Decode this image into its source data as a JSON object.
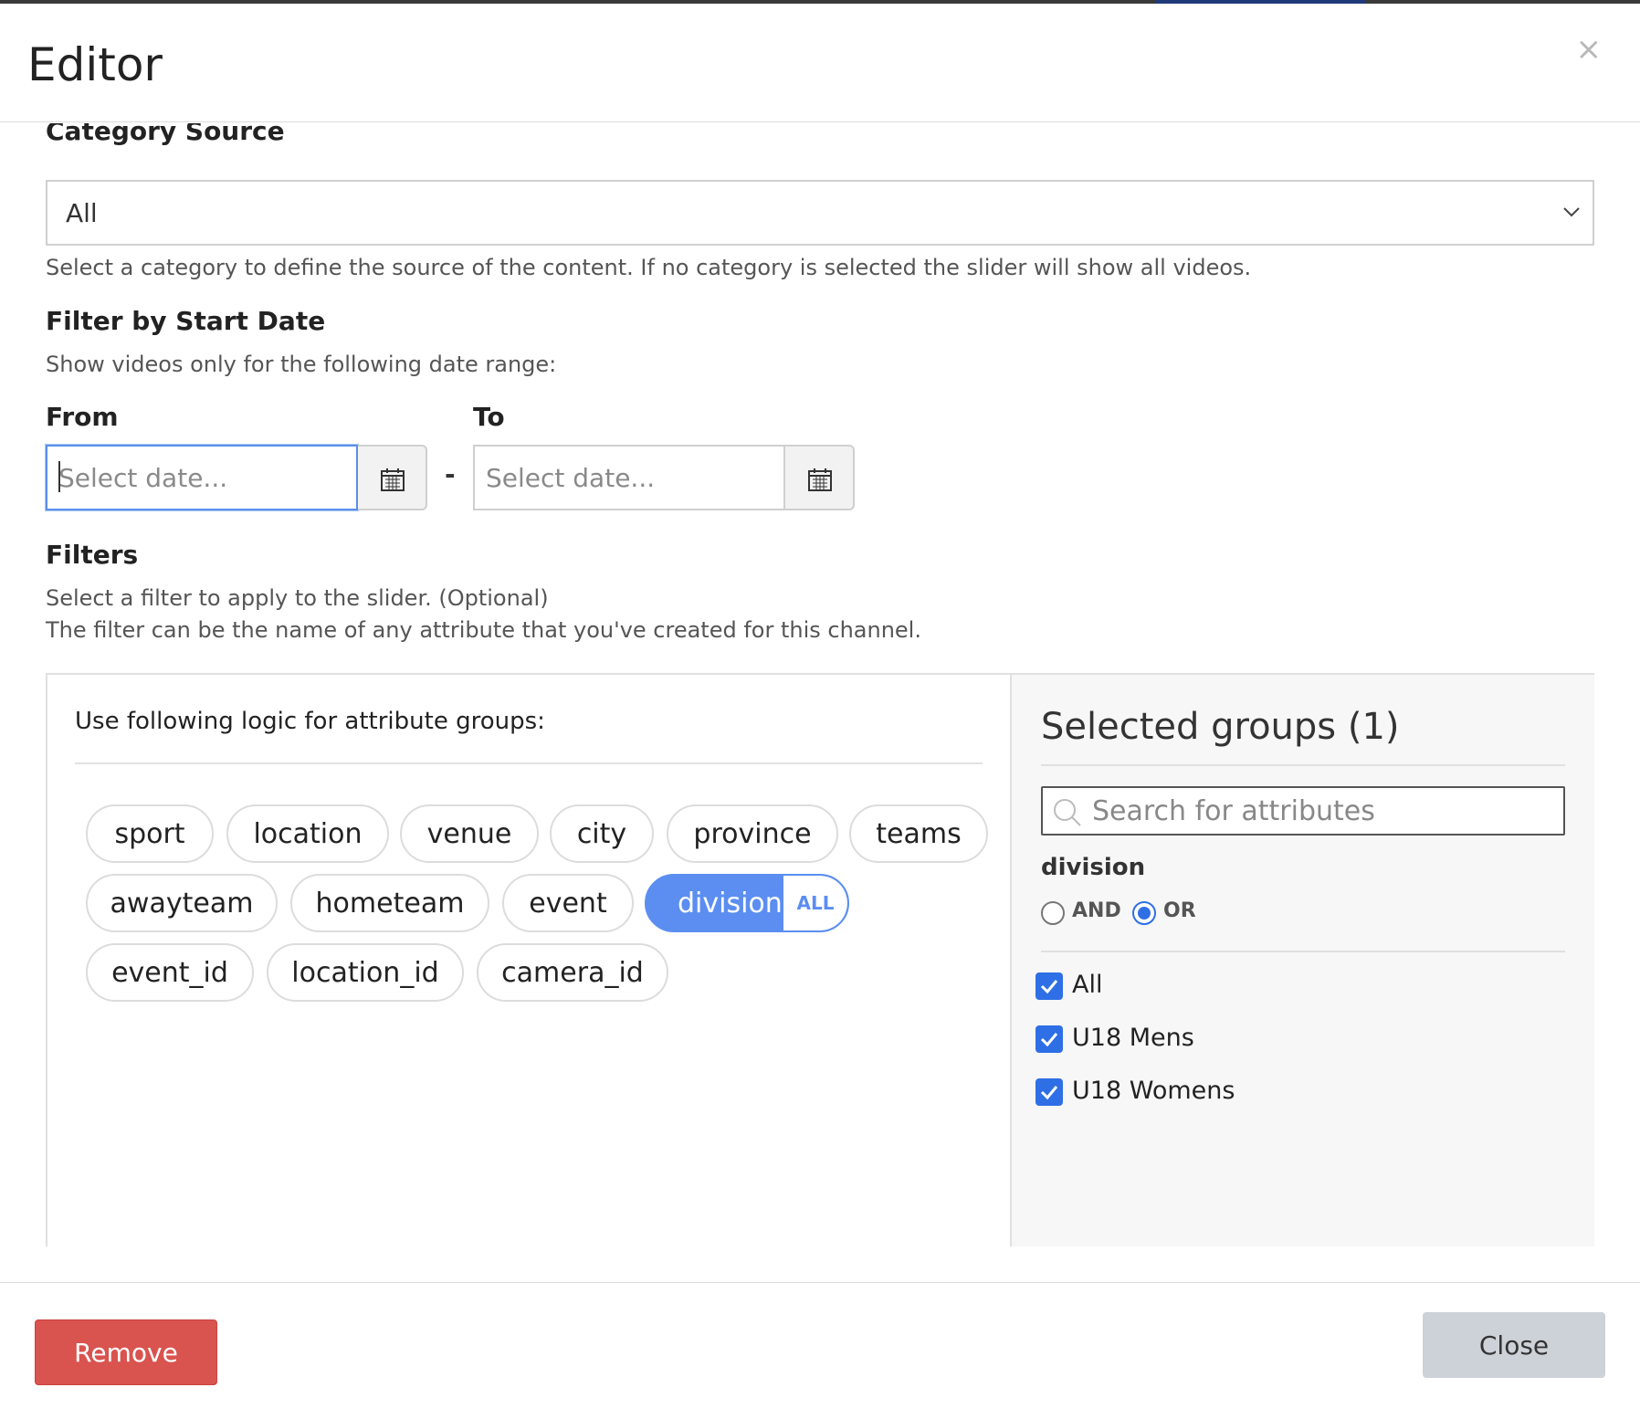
{
  "dialog": {
    "title": "Editor",
    "close_icon": "×"
  },
  "category": {
    "label": "Category Source",
    "selected": "All",
    "help": "Select a category to define the source of the content. If no category is selected the slider will show all videos."
  },
  "date_filter": {
    "label": "Filter by Start Date",
    "help": "Show videos only for the following date range:",
    "from_label": "From",
    "to_label": "To",
    "from_placeholder": "Select date...",
    "to_placeholder": "Select date...",
    "separator": "-"
  },
  "filters": {
    "label": "Filters",
    "help_line1": "Select a filter to apply to the slider. (Optional)",
    "help_line2": "The filter can be the name of any attribute that you've created for this channel.",
    "logic_label": "Use following logic for attribute groups:",
    "chips": [
      "sport",
      "location",
      "venue",
      "city",
      "province",
      "teams",
      "awayteam",
      "hometeam",
      "event",
      "division",
      "event_id",
      "location_id",
      "camera_id"
    ],
    "active_chip_tag": "ALL"
  },
  "selected_groups": {
    "title": "Selected groups (1)",
    "search_placeholder": "Search for attributes",
    "group_name": "division",
    "logic_options": [
      "AND",
      "OR"
    ],
    "logic_selected": "OR",
    "options": [
      "All",
      "U18 Mens",
      "U18 Womens"
    ]
  },
  "footer": {
    "remove_label": "Remove",
    "close_label": "Close"
  },
  "colors": {
    "accent": "#5b8ef0",
    "danger": "#d9534f",
    "checkbox": "#2f6fe6"
  }
}
